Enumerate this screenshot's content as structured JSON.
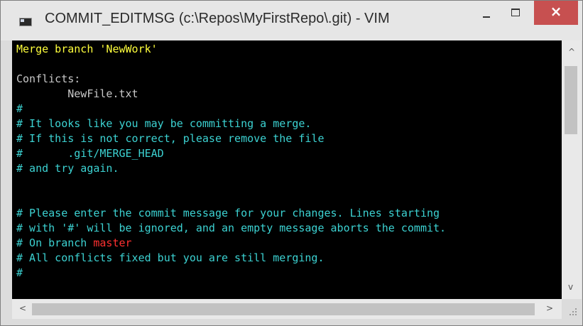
{
  "window": {
    "title": "COMMIT_EDITMSG (c:\\Repos\\MyFirstRepo\\.git) - VIM",
    "close_label": "×",
    "icons": {
      "app": "console-icon",
      "minimize": "minimize-icon",
      "maximize": "maximize-icon",
      "close": "close-icon"
    }
  },
  "editor": {
    "lines": {
      "l1": "Merge branch 'NewWork'",
      "l3": "Conflicts:",
      "l4": "        NewFile.txt",
      "l5": "#",
      "l6": "# It looks like you may be committing a merge.",
      "l7": "# If this is not correct, please remove the file",
      "l8": "#       .git/MERGE_HEAD",
      "l9": "# and try again.",
      "l12": "# Please enter the commit message for your changes. Lines starting",
      "l13": "# with '#' will be ignored, and an empty message aborts the commit.",
      "l14_prefix": "# On branch ",
      "l14_branch": "master",
      "l15": "# All conflicts fixed but you are still merging.",
      "l16": "#"
    },
    "colors": {
      "background": "#000000",
      "merge_line": "#ffff3c",
      "conflicts": "#c8c8c8",
      "comment": "#3cd2d2",
      "branch": "#ff3030"
    }
  },
  "scrollbars": {
    "up_arrow": "^",
    "down_arrow": "v",
    "left_arrow": "<",
    "right_arrow": ">",
    "icons": {
      "up": "scroll-up-icon",
      "down": "scroll-down-icon",
      "left": "scroll-left-icon",
      "right": "scroll-right-icon",
      "grip": "resize-grip-icon"
    }
  }
}
